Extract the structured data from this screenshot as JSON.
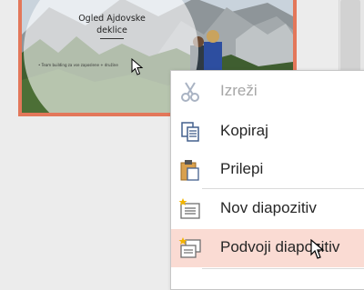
{
  "slide": {
    "title": "Ogled Ajdovske\ndeklice",
    "bullet": "• Team building za vse zaposlene + družine"
  },
  "context_menu": {
    "items": [
      {
        "label": "Izreži",
        "icon": "scissors-icon",
        "enabled": false
      },
      {
        "label": "Kopiraj",
        "icon": "copy-icon",
        "enabled": true
      },
      {
        "label": "Prilepi",
        "icon": "paste-icon",
        "enabled": true
      },
      {
        "label": "Nov diapozitiv",
        "icon": "new-slide-icon",
        "enabled": true
      },
      {
        "label": "Podvoji diapozitiv",
        "icon": "duplicate-slide-icon",
        "enabled": true,
        "highlighted": true
      }
    ]
  },
  "colors": {
    "selection_border": "#e3775a",
    "highlight": "#fadbd3"
  }
}
